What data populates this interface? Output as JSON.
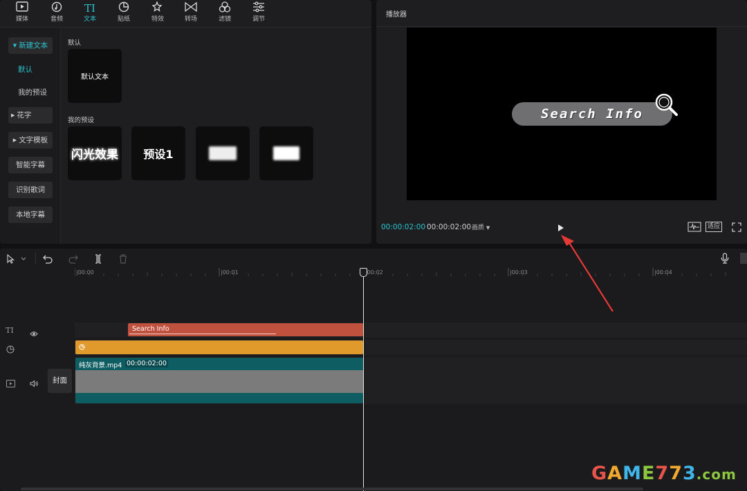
{
  "toolbar": {
    "tabs": [
      {
        "label": "媒体",
        "icon": "media-icon"
      },
      {
        "label": "音频",
        "icon": "audio-icon"
      },
      {
        "label": "文本",
        "icon": "text-icon",
        "active": true
      },
      {
        "label": "贴纸",
        "icon": "sticker-icon"
      },
      {
        "label": "特效",
        "icon": "effects-icon"
      },
      {
        "label": "转场",
        "icon": "transition-icon"
      },
      {
        "label": "滤镜",
        "icon": "filter-icon"
      },
      {
        "label": "调节",
        "icon": "adjust-icon"
      }
    ]
  },
  "sidebar": {
    "new_text": "新建文本",
    "default": "默认",
    "my_presets": "我的预设",
    "fancy_text": "花字",
    "text_template": "文字模板",
    "smart_caption": "智能字幕",
    "lyrics": "识别歌词",
    "local_caption": "本地字幕"
  },
  "content": {
    "default_section": "默认",
    "default_card": "默认文本",
    "presets_section": "我的预设",
    "preset_cards": [
      "闪光效果",
      "预设1",
      "",
      ""
    ]
  },
  "player": {
    "title": "播放器",
    "current_time": "00:00:02:00",
    "total_time": "00:00:02:00",
    "quality_label": "画质",
    "fit_label": "适应",
    "preview_text": "Search Info",
    "accent_color": "#2bc3cf"
  },
  "timeline": {
    "ticks": [
      "|00:00",
      "|00:01",
      "|00:02",
      "|00:03",
      "|00:04"
    ],
    "text_clip": "Search Info",
    "video_clip_name": "纯灰背景.mp4",
    "video_clip_duration": "00:00:02:00",
    "cover_label": "封面"
  },
  "watermark": {
    "text": "GAME773.com"
  }
}
